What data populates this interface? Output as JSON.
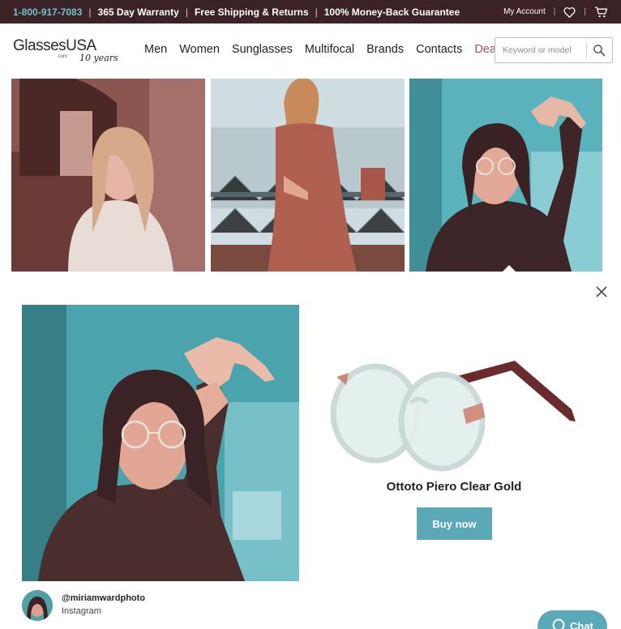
{
  "topbar": {
    "phone": "1-800-917-7083",
    "promos": [
      "365 Day Warranty",
      "Free Shipping & Returns",
      "100% Money-Back Guarantee"
    ],
    "account_label": "My Account",
    "icons": [
      "heart-icon",
      "cart-icon"
    ]
  },
  "header": {
    "logo": {
      "brand": "GlassesUSA",
      "suffix": ".com",
      "anniversary": "10 years"
    },
    "nav": [
      "Men",
      "Women",
      "Sunglasses",
      "Multifocal",
      "Brands",
      "Contacts",
      "Deals"
    ],
    "search": {
      "placeholder": "Keyword or model",
      "icon": "search-icon"
    }
  },
  "colors": {
    "topbar_bg": "#3a2226",
    "phone": "#6fc3d3",
    "deals": "#a3525c",
    "accent": "#5aa8b8"
  },
  "gallery": {
    "images": [
      {
        "description_icon": "photo"
      },
      {
        "description_icon": "photo"
      },
      {
        "description_icon": "photo"
      }
    ]
  },
  "modal": {
    "close_icon": "close-icon",
    "product": {
      "name": "Ottoto Piero Clear Gold",
      "cta": "Buy now"
    },
    "credit": {
      "handle": "@miriamwardphoto",
      "source": "Instagram"
    }
  },
  "chat": {
    "label": "Chat",
    "icon": "chat-icon"
  }
}
